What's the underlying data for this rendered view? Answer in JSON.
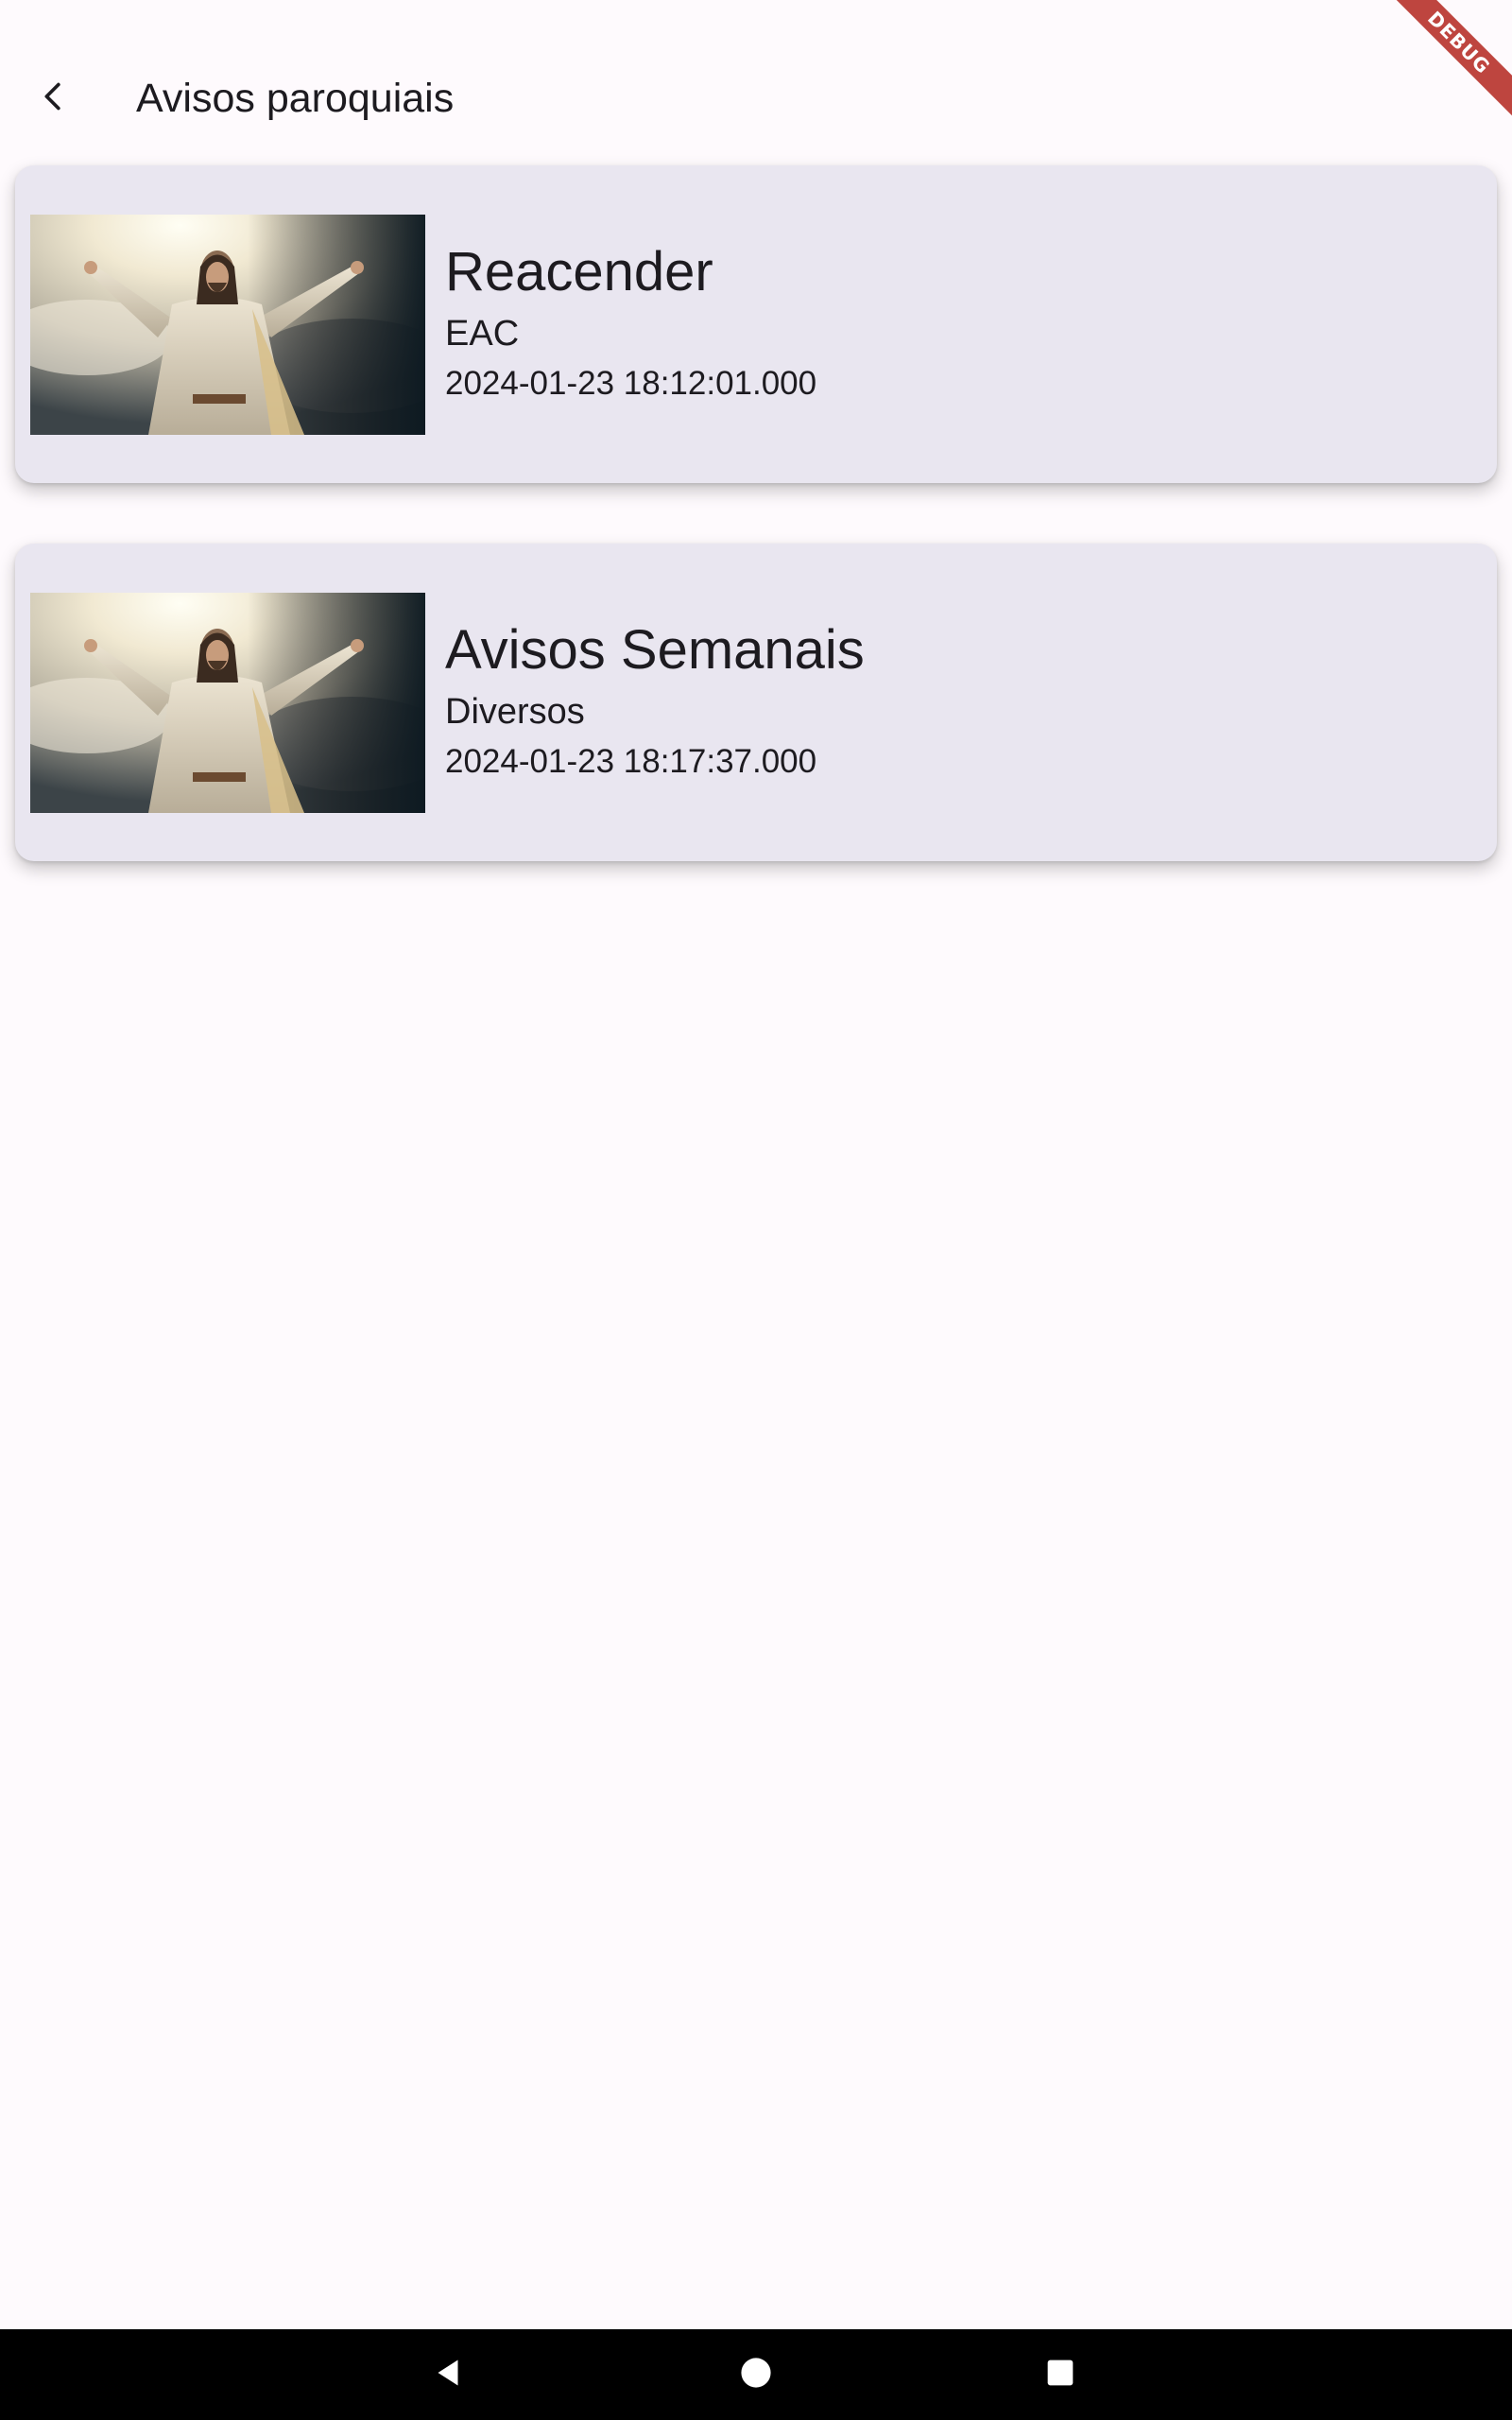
{
  "debug_ribbon": {
    "label": "DEBUG",
    "color": "#b3261e"
  },
  "app_bar": {
    "title": "Avisos paroquiais",
    "back_icon": "chevron-left-icon"
  },
  "notices": [
    {
      "title": "Reacender",
      "subtitle": "EAC",
      "date": "2024-01-23 18:12:01.000",
      "image": "jesus-arms-raised-image"
    },
    {
      "title": "Avisos Semanais",
      "subtitle": "Diversos",
      "date": "2024-01-23 18:17:37.000",
      "image": "jesus-arms-raised-image"
    }
  ],
  "nav_bar": {
    "back": "triangle-back-icon",
    "home": "circle-home-icon",
    "recents": "square-recents-icon"
  },
  "colors": {
    "background": "#fefafd",
    "card": "#e9e6f0",
    "text": "#1d1b20",
    "nav": "#000000"
  }
}
